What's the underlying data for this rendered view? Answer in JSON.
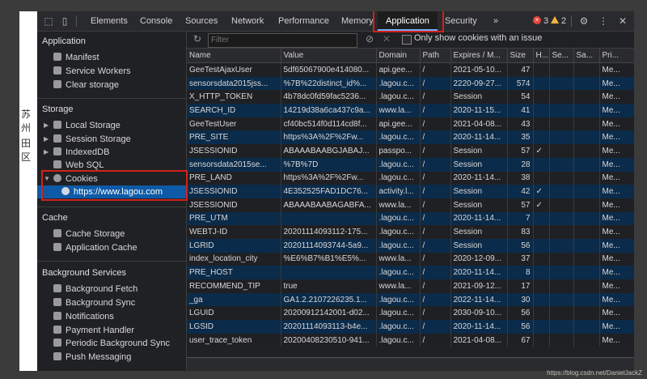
{
  "page_text": {
    "line1": "苏州",
    "line2": "田区"
  },
  "tabs": [
    "Elements",
    "Console",
    "Sources",
    "Network",
    "Performance",
    "Memory",
    "Application",
    "Security"
  ],
  "more_tabs": "»",
  "errors_count": "3",
  "warnings_count": "2",
  "sidebar": {
    "application_title": "Application",
    "application_items": [
      "Manifest",
      "Service Workers",
      "Clear storage"
    ],
    "storage_title": "Storage",
    "storage_items": [
      "Local Storage",
      "Session Storage",
      "IndexedDB",
      "Web SQL",
      "Cookies"
    ],
    "cookie_origin": "https://www.lagou.com",
    "cache_title": "Cache",
    "cache_items": [
      "Cache Storage",
      "Application Cache"
    ],
    "bg_title": "Background Services",
    "bg_items": [
      "Background Fetch",
      "Background Sync",
      "Notifications",
      "Payment Handler",
      "Periodic Background Sync",
      "Push Messaging"
    ]
  },
  "toolbar": {
    "filter_placeholder": "Filter",
    "only_issue_label": "Only show cookies with an issue"
  },
  "table": {
    "headers": [
      "Name",
      "Value",
      "Domain",
      "Path",
      "Expires / M...",
      "Size",
      "H...",
      "Se...",
      "Sa...",
      "Pri..."
    ],
    "rows": [
      [
        "GeeTestAjaxUser",
        "5df65067900e414080...",
        "api.gee...",
        "/",
        "2021-05-10...",
        "47",
        "",
        "",
        "",
        "Me..."
      ],
      [
        "sensorsdata2015jss...",
        "%7B%22distinct_id%...",
        ".lagou.c...",
        "/",
        "2220-09-27...",
        "574",
        "",
        "",
        "",
        "Me..."
      ],
      [
        "X_HTTP_TOKEN",
        "4b78dc0fd59fac5236...",
        ".lagou.c...",
        "/",
        "Session",
        "54",
        "",
        "",
        "",
        "Me..."
      ],
      [
        "SEARCH_ID",
        "14219d38a6ca437c9a...",
        "www.la...",
        "/",
        "2020-11-15...",
        "41",
        "",
        "",
        "",
        "Me..."
      ],
      [
        "GeeTestUser",
        "cf40bc514f0d114cd8f...",
        "api.gee...",
        "/",
        "2021-04-08...",
        "43",
        "",
        "",
        "",
        "Me..."
      ],
      [
        "PRE_SITE",
        "https%3A%2F%2Fw...",
        ".lagou.c...",
        "/",
        "2020-11-14...",
        "35",
        "",
        "",
        "",
        "Me..."
      ],
      [
        "JSESSIONID",
        "ABAAABAABGJABAJ...",
        "passpo...",
        "/",
        "Session",
        "57",
        "✓",
        "",
        "",
        "Me..."
      ],
      [
        "sensorsdata2015se...",
        "%7B%7D",
        ".lagou.c...",
        "/",
        "Session",
        "28",
        "",
        "",
        "",
        "Me..."
      ],
      [
        "PRE_LAND",
        "https%3A%2F%2Fw...",
        ".lagou.c...",
        "/",
        "2020-11-14...",
        "38",
        "",
        "",
        "",
        "Me..."
      ],
      [
        "JSESSIONID",
        "4E352525FAD1DC76...",
        "activity.l...",
        "/",
        "Session",
        "42",
        "✓",
        "",
        "",
        "Me..."
      ],
      [
        "JSESSIONID",
        "ABAAABAABAGABFA...",
        "www.la...",
        "/",
        "Session",
        "57",
        "✓",
        "",
        "",
        "Me..."
      ],
      [
        "PRE_UTM",
        "",
        ".lagou.c...",
        "/",
        "2020-11-14...",
        "7",
        "",
        "",
        "",
        "Me..."
      ],
      [
        "WEBTJ-ID",
        "20201114093112-175...",
        ".lagou.c...",
        "/",
        "Session",
        "83",
        "",
        "",
        "",
        "Me..."
      ],
      [
        "LGRID",
        "20201114093744-5a9...",
        ".lagou.c...",
        "/",
        "Session",
        "56",
        "",
        "",
        "",
        "Me..."
      ],
      [
        "index_location_city",
        "%E6%B7%B1%E5%...",
        "www.la...",
        "/",
        "2020-12-09...",
        "37",
        "",
        "",
        "",
        "Me..."
      ],
      [
        "PRE_HOST",
        "",
        ".lagou.c...",
        "/",
        "2020-11-14...",
        "8",
        "",
        "",
        "",
        "Me..."
      ],
      [
        "RECOMMEND_TIP",
        "true",
        "www.la...",
        "/",
        "2021-09-12...",
        "17",
        "",
        "",
        "",
        "Me..."
      ],
      [
        "_ga",
        "GA1.2.2107226235.1...",
        ".lagou.c...",
        "/",
        "2022-11-14...",
        "30",
        "",
        "",
        "",
        "Me..."
      ],
      [
        "LGUID",
        "20200912142001-d02...",
        ".lagou.c...",
        "/",
        "2030-09-10...",
        "56",
        "",
        "",
        "",
        "Me..."
      ],
      [
        "LGSID",
        "20201114093113-b4e...",
        ".lagou.c...",
        "/",
        "2020-11-14...",
        "56",
        "",
        "",
        "",
        "Me..."
      ],
      [
        "user_trace_token",
        "20200408230510-941...",
        ".lagou.c...",
        "/",
        "2021-04-08...",
        "67",
        "",
        "",
        "",
        "Me..."
      ]
    ]
  },
  "watermark": "https://blog.csdn.net/DanielJackZ",
  "colors": {
    "accent": "#0e5aa7",
    "highlight_border": "#d0221a",
    "row_alt": "#0b2b4a"
  }
}
